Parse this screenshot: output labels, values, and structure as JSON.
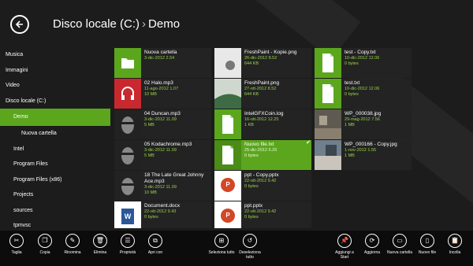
{
  "header": {
    "drive": "Disco locale (C:)",
    "separator": "›",
    "folder": "Demo"
  },
  "sidebar": {
    "items": [
      {
        "label": "Musica"
      },
      {
        "label": "Immagini"
      },
      {
        "label": "Video"
      },
      {
        "label": "Disco locale (C:)"
      },
      {
        "label": "Demo"
      },
      {
        "label": "Nuova cartella"
      },
      {
        "label": "Intel"
      },
      {
        "label": "Program Files"
      },
      {
        "label": "Program Files (x86)"
      },
      {
        "label": "Projects"
      },
      {
        "label": "sources"
      },
      {
        "label": "tpmvsc"
      }
    ]
  },
  "files": [
    {
      "name": "Nuova cartella",
      "date": "3-dic-2012 2.54",
      "size": ""
    },
    {
      "name": "FreshPaint - Kopie.png",
      "date": "26-dic-2012 8.52",
      "size": "644 KB"
    },
    {
      "name": "test - Copy.txt",
      "date": "10-dic-2012 12.06",
      "size": "0 bytes"
    },
    {
      "name": "02 Halo.mp3",
      "date": "11-ago-2012 1.07",
      "size": "10 MB"
    },
    {
      "name": "FreshPaint.png",
      "date": "27-ott-2012 8.52",
      "size": "644 KB"
    },
    {
      "name": "test.txt",
      "date": "10-dic-2012 12.06",
      "size": "0 bytes"
    },
    {
      "name": "04 Duncan.mp3",
      "date": "3-dic-2012 11.09",
      "size": "5 MB"
    },
    {
      "name": "IntelGFXCoin.log",
      "date": "16-ott-2012 12.25",
      "size": "1 KB"
    },
    {
      "name": "WP_000038.jpg",
      "date": "29-mag-2012 7.56",
      "size": "1 MB"
    },
    {
      "name": "05 Kodachrome.mp3",
      "date": "3-dic-2012 11.09",
      "size": "5 MB"
    },
    {
      "name": "Nuovo file.txt",
      "date": "25-dic-2012 5.26",
      "size": "0 bytes"
    },
    {
      "name": "WP_000166 - Copy.jpg",
      "date": "1-nov-2012 1.55",
      "size": "1 MB"
    },
    {
      "name": "18 The Late Great Johnny Ace.mp3",
      "date": "3-dic-2012 11.09",
      "size": "10 MB"
    },
    {
      "name": "ppt - Copy.pptx",
      "date": "22-ott-2012 9.42",
      "size": "0 bytes"
    },
    {
      "name": "",
      "date": "",
      "size": ""
    },
    {
      "name": "Document.docx",
      "date": "22-ott-2012 9.43",
      "size": "0 bytes"
    },
    {
      "name": "ppt.pptx",
      "date": "22-ott-2012 9.42",
      "size": "0 bytes"
    },
    {
      "name": "",
      "date": "",
      "size": ""
    }
  ],
  "appbar": {
    "taglia": "Taglia",
    "copia": "Copia",
    "rinomina": "Rinomina",
    "elimina": "Elimina",
    "proprieta": "Proprietà",
    "apri_con": "Apri con",
    "seleziona_tutto": "Seleziona tutto",
    "deseleziona_tutto": "Deseleziona tutto",
    "aggiungi_start": "Aggiungi a Start",
    "aggiorna": "Aggiorna",
    "nuova_cartella": "Nuova cartella",
    "nuovo_file": "Nuovo file",
    "incolla": "Incolla"
  },
  "colors": {
    "accent": "#5ba61d",
    "mp3": "#c9282e",
    "background": "#1c1c1c"
  }
}
